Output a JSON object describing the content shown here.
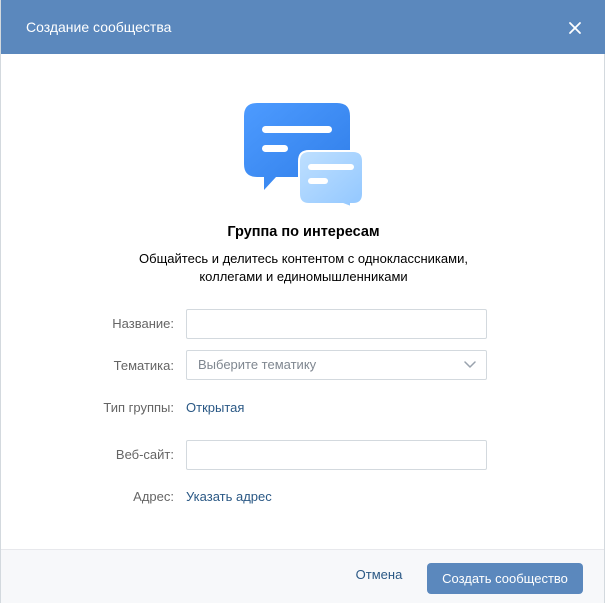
{
  "dialog": {
    "title": "Создание сообщества",
    "close_icon": "close-icon"
  },
  "group": {
    "icon": "chat-bubbles-icon",
    "title": "Группа по интересам",
    "description_line1": "Общайтесь и делитесь контентом с одноклассниками,",
    "description_line2": "коллегами и единомышленниками"
  },
  "form": {
    "name_label": "Название:",
    "name_value": "",
    "topic_label": "Тематика:",
    "topic_placeholder": "Выберите тематику",
    "group_type_label": "Тип группы:",
    "group_type_value": "Открытая",
    "website_label": "Веб-сайт:",
    "website_value": "",
    "address_label": "Адрес:",
    "address_link": "Указать адрес"
  },
  "footer": {
    "cancel_label": "Отмена",
    "create_label": "Создать сообщество"
  },
  "colors": {
    "header_bg": "#5b88bd",
    "link": "#2a5885",
    "primary_button": "#5b88bd",
    "footer_bg": "#f7f8fa"
  }
}
